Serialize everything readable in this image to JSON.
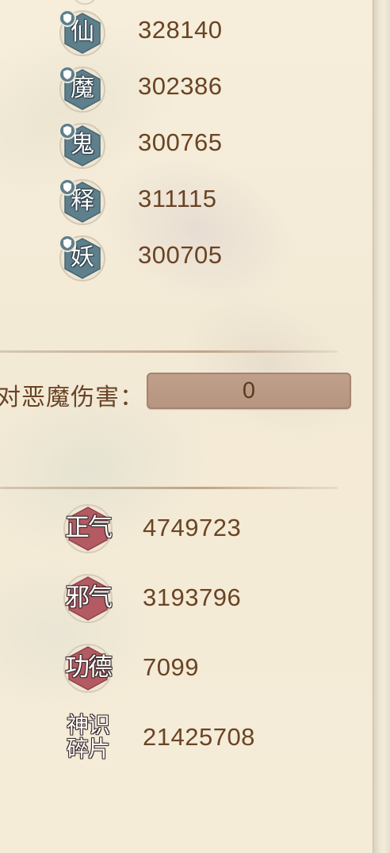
{
  "resistances": [
    {
      "char": "仙",
      "value": "328140"
    },
    {
      "char": "魔",
      "value": "302386"
    },
    {
      "char": "鬼",
      "value": "300765"
    },
    {
      "char": "释",
      "value": "311115"
    },
    {
      "char": "妖",
      "value": "300705"
    }
  ],
  "demon_damage": {
    "label": "对恶魔伤害：",
    "value": "0"
  },
  "currencies": [
    {
      "name": "正气",
      "value": "4749723"
    },
    {
      "name": "邪气",
      "value": "3193796"
    },
    {
      "name": "功德",
      "value": "7099"
    },
    {
      "name_line1": "神识",
      "name_line2": "碎片",
      "value": "21425708"
    }
  ],
  "colors": {
    "value_text": "#6a4424",
    "resist_hex_fill": "#5e7f8c",
    "currency_hex_fill": "#b35a63",
    "demon_box": "#b89884"
  },
  "icons": {
    "resist_badge": "shield-icon",
    "resist_frame": "hexagon-icon",
    "currency_frame": "hexagon-icon"
  }
}
